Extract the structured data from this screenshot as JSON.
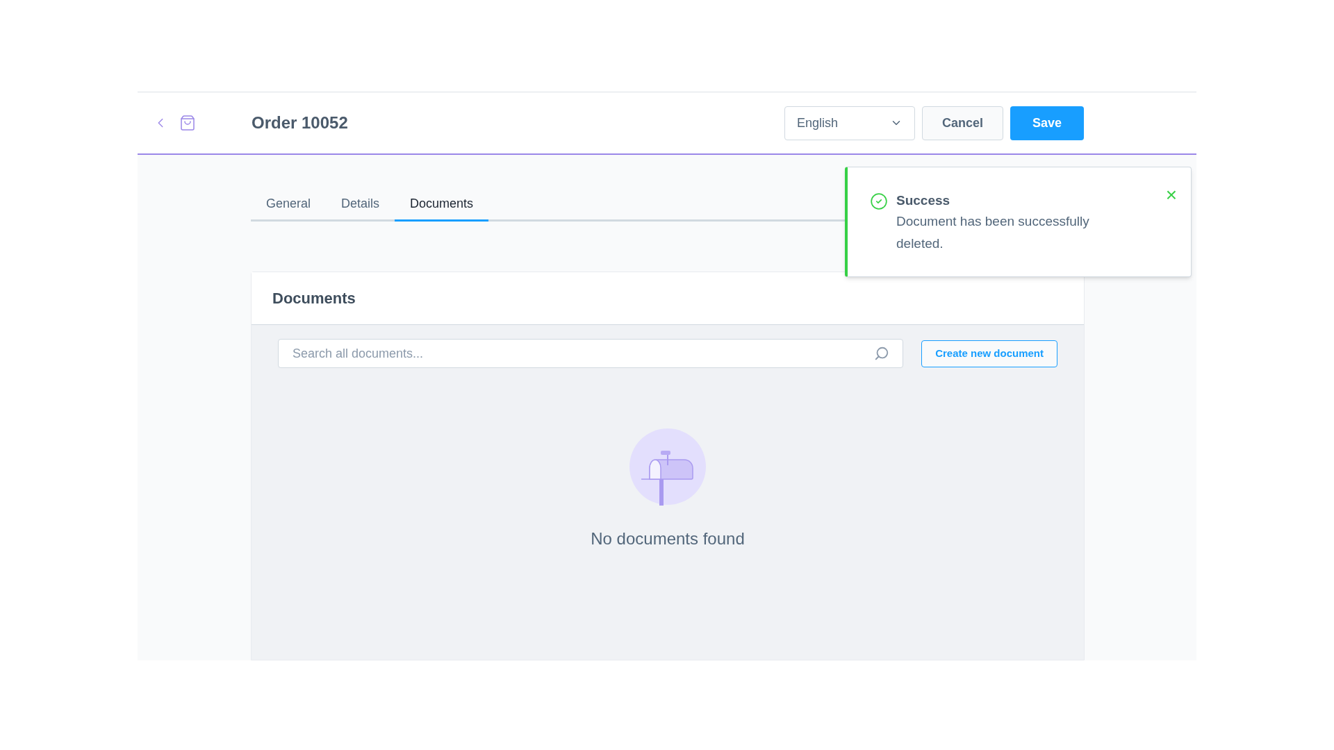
{
  "header": {
    "title": "Order 10052",
    "language": "English",
    "buttons": [
      {
        "label": "Cancel",
        "kind": "secondary"
      },
      {
        "label": "Save",
        "kind": "primary"
      }
    ]
  },
  "tabs": [
    {
      "label": "General",
      "selected": false
    },
    {
      "label": "Details",
      "selected": false
    },
    {
      "label": "Documents",
      "selected": true
    }
  ],
  "card": {
    "title": "Documents",
    "search": {
      "placeholder": "Search all documents..."
    },
    "create_button": "Create new document",
    "empty_message": "No documents found"
  },
  "toast": {
    "title": "Success",
    "message": "Document has been successfully deleted.",
    "close": "×"
  }
}
